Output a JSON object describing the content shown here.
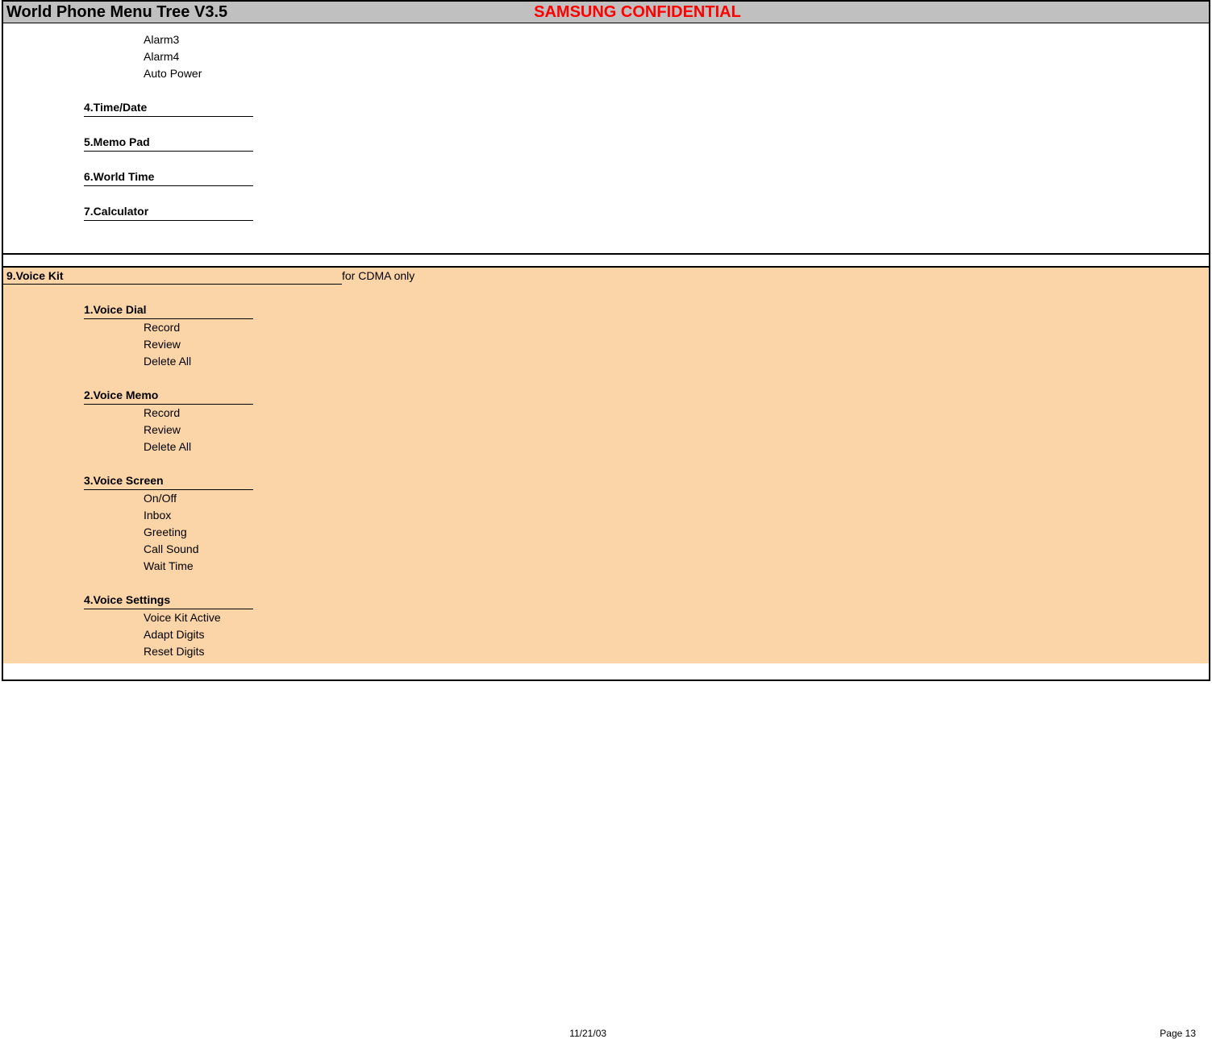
{
  "header": {
    "title": "World Phone Menu Tree V3.5",
    "confidential": "SAMSUNG CONFIDENTIAL"
  },
  "upper": {
    "tail_items": [
      "Alarm3",
      "Alarm4",
      "Auto Power"
    ],
    "menus": [
      "4.Time/Date",
      "5.Memo Pad",
      "6.World Time",
      "7.Calculator"
    ]
  },
  "voicekit": {
    "title": "9.Voice Kit",
    "note": "for CDMA only",
    "subs": [
      {
        "title": "1.Voice Dial",
        "items": [
          "Record",
          "Review",
          "Delete All"
        ]
      },
      {
        "title": "2.Voice Memo",
        "items": [
          "Record",
          "Review",
          "Delete All"
        ]
      },
      {
        "title": "3.Voice Screen",
        "items": [
          "On/Off",
          "Inbox",
          "Greeting",
          "Call Sound",
          "Wait Time"
        ]
      },
      {
        "title": "4.Voice Settings",
        "items": [
          "Voice Kit Active",
          "Adapt Digits",
          "Reset Digits"
        ]
      }
    ]
  },
  "footer": {
    "date": "11/21/03",
    "page": "Page 13"
  }
}
